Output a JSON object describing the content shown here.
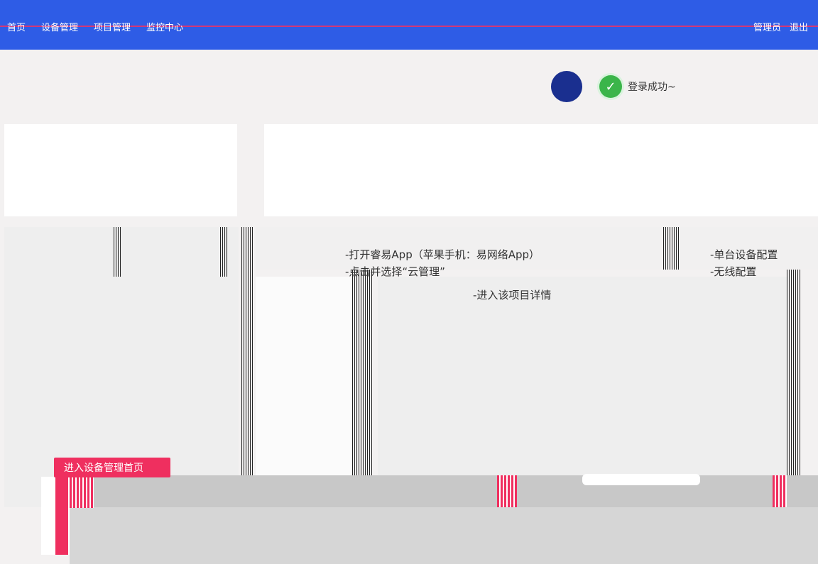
{
  "topbar": {
    "nav": [
      "首页",
      "设备管理",
      "项目管理",
      "监控中心"
    ],
    "user": "管理员",
    "logout": "退出"
  },
  "toast": {
    "message": "登录成功~"
  },
  "steps": {
    "line1": "-打开睿易App（苹果手机：易网络App）",
    "line2": "-点击并选择“云管理”",
    "line3": "-进入该项目详情"
  },
  "config": {
    "item1": "-单台设备配置",
    "item2": "-无线配置"
  },
  "cta": {
    "label": "进入设备管理首页"
  },
  "colors": {
    "topbar": "#2e5ce6",
    "accent": "#ef2f5f",
    "success": "#3bb54a"
  }
}
